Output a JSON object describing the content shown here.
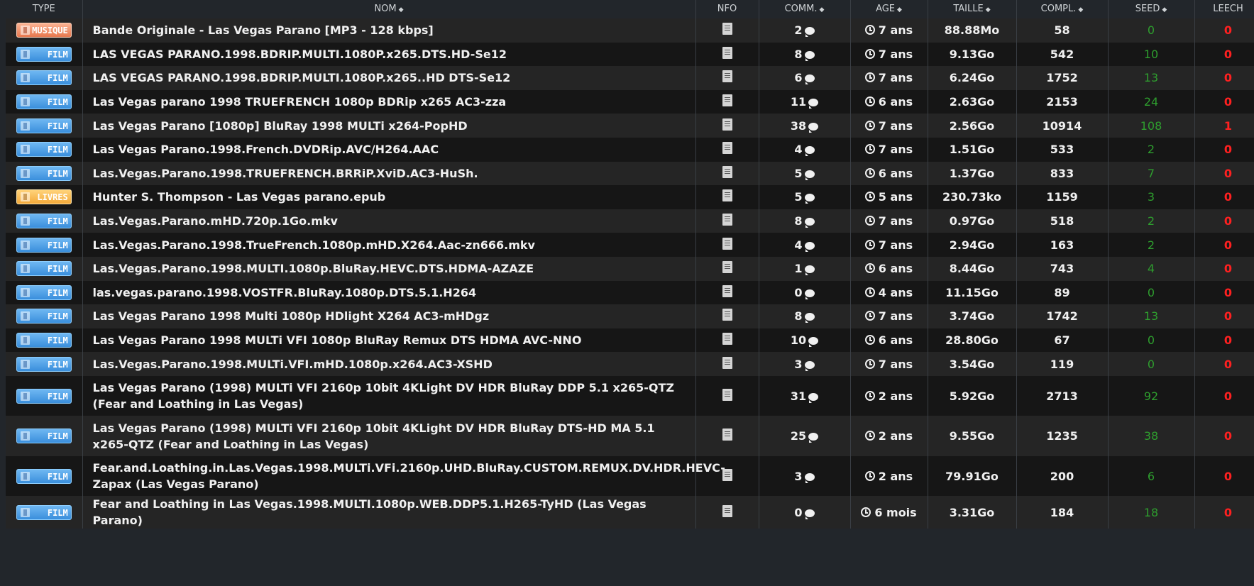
{
  "headers": {
    "type": "TYPE",
    "name": "NOM",
    "nfo": "NFO",
    "comm": "COMM.",
    "age": "AGE",
    "size": "TAILLE",
    "compl": "COMPL.",
    "seed": "SEED",
    "leech": "LEECH"
  },
  "colors": {
    "seed": "#2e9e2e",
    "leech": "#ff2020"
  },
  "rows": [
    {
      "type": "MUSIQUE",
      "cat": "musique",
      "name": "Bande Originale - Las Vegas Parano [MP3 - 128 kbps]",
      "comments": "2",
      "age": "7 ans",
      "size": "88.88Mo",
      "completed": "58",
      "seed": "0",
      "leech": "0"
    },
    {
      "type": "FILM",
      "cat": "film",
      "name": "LAS VEGAS PARANO.1998.BDRIP.MULTI.1080P.x265.DTS.HD-Se12",
      "comments": "8",
      "age": "7 ans",
      "size": "9.13Go",
      "completed": "542",
      "seed": "10",
      "leech": "0"
    },
    {
      "type": "FILM",
      "cat": "film",
      "name": "LAS VEGAS PARANO.1998.BDRIP.MULTI.1080P.x265..HD DTS-Se12",
      "comments": "6",
      "age": "7 ans",
      "size": "6.24Go",
      "completed": "1752",
      "seed": "13",
      "leech": "0"
    },
    {
      "type": "FILM",
      "cat": "film",
      "name": "Las Vegas parano 1998 TRUEFRENCH 1080p BDRip x265 AC3-zza",
      "comments": "11",
      "age": "6 ans",
      "size": "2.63Go",
      "completed": "2153",
      "seed": "24",
      "leech": "0"
    },
    {
      "type": "FILM",
      "cat": "film",
      "name": "Las Vegas Parano [1080p] BluRay 1998 MULTi x264-PopHD",
      "comments": "38",
      "age": "7 ans",
      "size": "2.56Go",
      "completed": "10914",
      "seed": "108",
      "leech": "1"
    },
    {
      "type": "FILM",
      "cat": "film",
      "name": "Las Vegas Parano.1998.French.DVDRip.AVC/H264.AAC",
      "comments": "4",
      "age": "7 ans",
      "size": "1.51Go",
      "completed": "533",
      "seed": "2",
      "leech": "0"
    },
    {
      "type": "FILM",
      "cat": "film",
      "name": "Las.Vegas.Parano.1998.TRUEFRENCH.BRRiP.XviD.AC3-HuSh.",
      "comments": "5",
      "age": "6 ans",
      "size": "1.37Go",
      "completed": "833",
      "seed": "7",
      "leech": "0"
    },
    {
      "type": "LIVRES",
      "cat": "livres",
      "name": "Hunter S. Thompson - Las Vegas parano.epub",
      "comments": "5",
      "age": "5 ans",
      "size": "230.73ko",
      "completed": "1159",
      "seed": "3",
      "leech": "0"
    },
    {
      "type": "FILM",
      "cat": "film",
      "name": "Las.Vegas.Parano.mHD.720p.1Go.mkv",
      "comments": "8",
      "age": "7 ans",
      "size": "0.97Go",
      "completed": "518",
      "seed": "2",
      "leech": "0"
    },
    {
      "type": "FILM",
      "cat": "film",
      "name": "Las.Vegas.Parano.1998.TrueFrench.1080p.mHD.X264.Aac-zn666.mkv",
      "comments": "4",
      "age": "7 ans",
      "size": "2.94Go",
      "completed": "163",
      "seed": "2",
      "leech": "0"
    },
    {
      "type": "FILM",
      "cat": "film",
      "name": "Las.Vegas.Parano.1998.MULTI.1080p.BluRay.HEVC.DTS.HDMA-AZAZE",
      "comments": "1",
      "age": "6 ans",
      "size": "8.44Go",
      "completed": "743",
      "seed": "4",
      "leech": "0"
    },
    {
      "type": "FILM",
      "cat": "film",
      "name": "las.vegas.parano.1998.VOSTFR.BluRay.1080p.DTS.5.1.H264",
      "comments": "0",
      "age": "4 ans",
      "size": "11.15Go",
      "completed": "89",
      "seed": "0",
      "leech": "0"
    },
    {
      "type": "FILM",
      "cat": "film",
      "name": "Las Vegas Parano 1998 Multi 1080p HDlight X264 AC3-mHDgz",
      "comments": "8",
      "age": "7 ans",
      "size": "3.74Go",
      "completed": "1742",
      "seed": "13",
      "leech": "0"
    },
    {
      "type": "FILM",
      "cat": "film",
      "name": "Las Vegas Parano 1998 MULTi VFI 1080p BluRay Remux DTS HDMA AVC-NNO",
      "comments": "10",
      "age": "6 ans",
      "size": "28.80Go",
      "completed": "67",
      "seed": "0",
      "leech": "0"
    },
    {
      "type": "FILM",
      "cat": "film",
      "name": "Las.Vegas.Parano.1998.MULTi.VFI.mHD.1080p.x264.AC3-XSHD",
      "comments": "3",
      "age": "7 ans",
      "size": "3.54Go",
      "completed": "119",
      "seed": "0",
      "leech": "0"
    },
    {
      "type": "FILM",
      "cat": "film",
      "name": "Las Vegas Parano (1998) MULTi VFI 2160p 10bit 4KLight DV HDR BluRay DDP 5.1 x265-QTZ (Fear and Loathing in Las Vegas)",
      "comments": "31",
      "age": "2 ans",
      "size": "5.92Go",
      "completed": "2713",
      "seed": "92",
      "leech": "0"
    },
    {
      "type": "FILM",
      "cat": "film",
      "name": "Las Vegas Parano (1998) MULTi VFI 2160p 10bit 4KLight DV HDR BluRay DTS-HD MA 5.1 x265-QTZ (Fear and Loathing in Las Vegas)",
      "comments": "25",
      "age": "2 ans",
      "size": "9.55Go",
      "completed": "1235",
      "seed": "38",
      "leech": "0"
    },
    {
      "type": "FILM",
      "cat": "film",
      "name": "Fear.and.Loathing.in.Las.Vegas.1998.MULTi.VFi.2160p.UHD.BluRay.CUSTOM.REMUX.DV.HDR.HEVC-Zapax (Las Vegas Parano)",
      "comments": "3",
      "age": "2 ans",
      "size": "79.91Go",
      "completed": "200",
      "seed": "6",
      "leech": "0"
    },
    {
      "type": "FILM",
      "cat": "film",
      "name": "Fear and Loathing in Las Vegas.1998.MULTI.1080p.WEB.DDP5.1.H265-TyHD (Las Vegas Parano)",
      "comments": "0",
      "age": "6 mois",
      "size": "3.31Go",
      "completed": "184",
      "seed": "18",
      "leech": "0"
    }
  ]
}
